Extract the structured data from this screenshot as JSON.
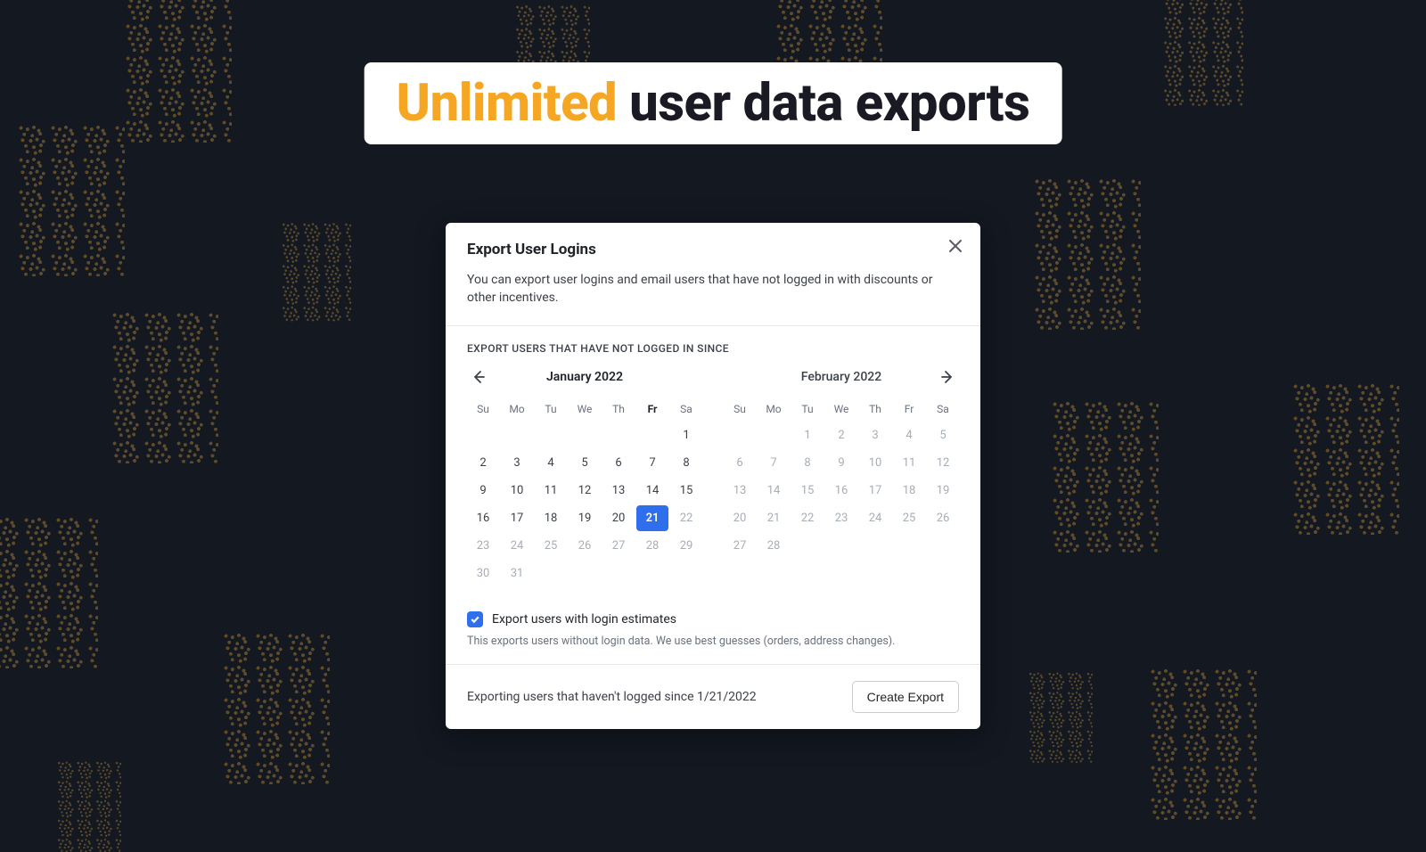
{
  "headline": {
    "accent": "Unlimited",
    "rest": " user data exports"
  },
  "modal": {
    "title": "Export User Logins",
    "description": "You can export user logins and email users that have not logged in with discounts or other incentives.",
    "section_label": "EXPORT USERS THAT HAVE NOT LOGGED IN SINCE",
    "dow": [
      "Su",
      "Mo",
      "Tu",
      "We",
      "Th",
      "Fr",
      "Sa"
    ],
    "left_month": {
      "title": "January 2022",
      "today_dow_index": 5,
      "leading_blanks": 6,
      "days": 31,
      "selected": 21,
      "muted_from": 22
    },
    "right_month": {
      "title": "February 2022",
      "leading_blanks": 2,
      "days": 28,
      "muted_all": true
    },
    "checkbox": {
      "checked": true,
      "label": "Export users with login estimates",
      "help": "This exports users without login data. We use best guesses (orders, address changes)."
    },
    "footer": {
      "status": "Exporting users that haven't logged since 1/21/2022",
      "button": "Create Export"
    }
  },
  "colors": {
    "accent_orange": "#f5a623",
    "primary_blue": "#2f6fed",
    "bg": "#131821"
  }
}
